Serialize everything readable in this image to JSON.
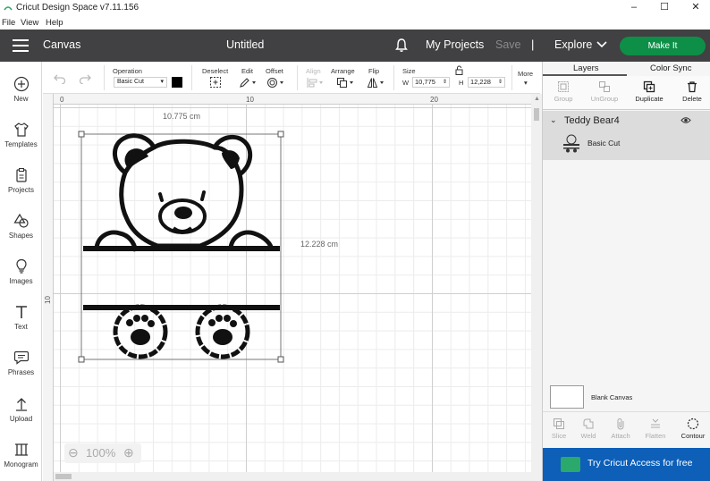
{
  "window": {
    "title": "Cricut Design Space  v7.11.156",
    "min": "–",
    "max": "☐",
    "close": "✕"
  },
  "menubar": {
    "items": [
      "File",
      "View",
      "Help"
    ]
  },
  "header": {
    "section": "Canvas",
    "doc_title": "Untitled",
    "my_projects": "My Projects",
    "save": "Save",
    "separator": "|",
    "explore": "Explore",
    "make_it": "Make It",
    "colors": {
      "bar": "#414042",
      "make_it": "#0e8f48"
    }
  },
  "sidebar": {
    "items": [
      {
        "label": "New",
        "icon": "plus-circle-icon"
      },
      {
        "label": "Templates",
        "icon": "shirt-icon"
      },
      {
        "label": "Projects",
        "icon": "clipboard-icon"
      },
      {
        "label": "Shapes",
        "icon": "shapes-icon"
      },
      {
        "label": "Images",
        "icon": "bulb-icon"
      },
      {
        "label": "Text",
        "icon": "text-icon"
      },
      {
        "label": "Phrases",
        "icon": "speech-bubble-icon"
      },
      {
        "label": "Upload",
        "icon": "upload-icon"
      },
      {
        "label": "Monogram",
        "icon": "monogram-icon"
      }
    ]
  },
  "toolbar": {
    "operation_label": "Operation",
    "operation_value": "Basic Cut",
    "deselect": "Deselect",
    "edit": "Edit",
    "offset": "Offset",
    "align": "Align",
    "arrange": "Arrange",
    "flip": "Flip",
    "size": "Size",
    "w_label": "W",
    "w_value": "10,775",
    "h_label": "H",
    "h_value": "12,228",
    "more": "More"
  },
  "canvas": {
    "ruler_top": [
      "0",
      "10",
      "20"
    ],
    "ruler_left": [
      "10"
    ],
    "width_label": "10.775 cm",
    "height_label": "12.228 cm",
    "zoom": "100%"
  },
  "panel": {
    "tabs": [
      "Layers",
      "Color Sync"
    ],
    "actions": [
      "Group",
      "UnGroup",
      "Duplicate",
      "Delete"
    ],
    "group_name": "Teddy Bear4",
    "layer_name": "Basic Cut",
    "blank_canvas": "Blank Canvas",
    "bottom_actions": [
      "Slice",
      "Weld",
      "Attach",
      "Flatten",
      "Contour"
    ],
    "access": "Try Cricut Access for free"
  }
}
